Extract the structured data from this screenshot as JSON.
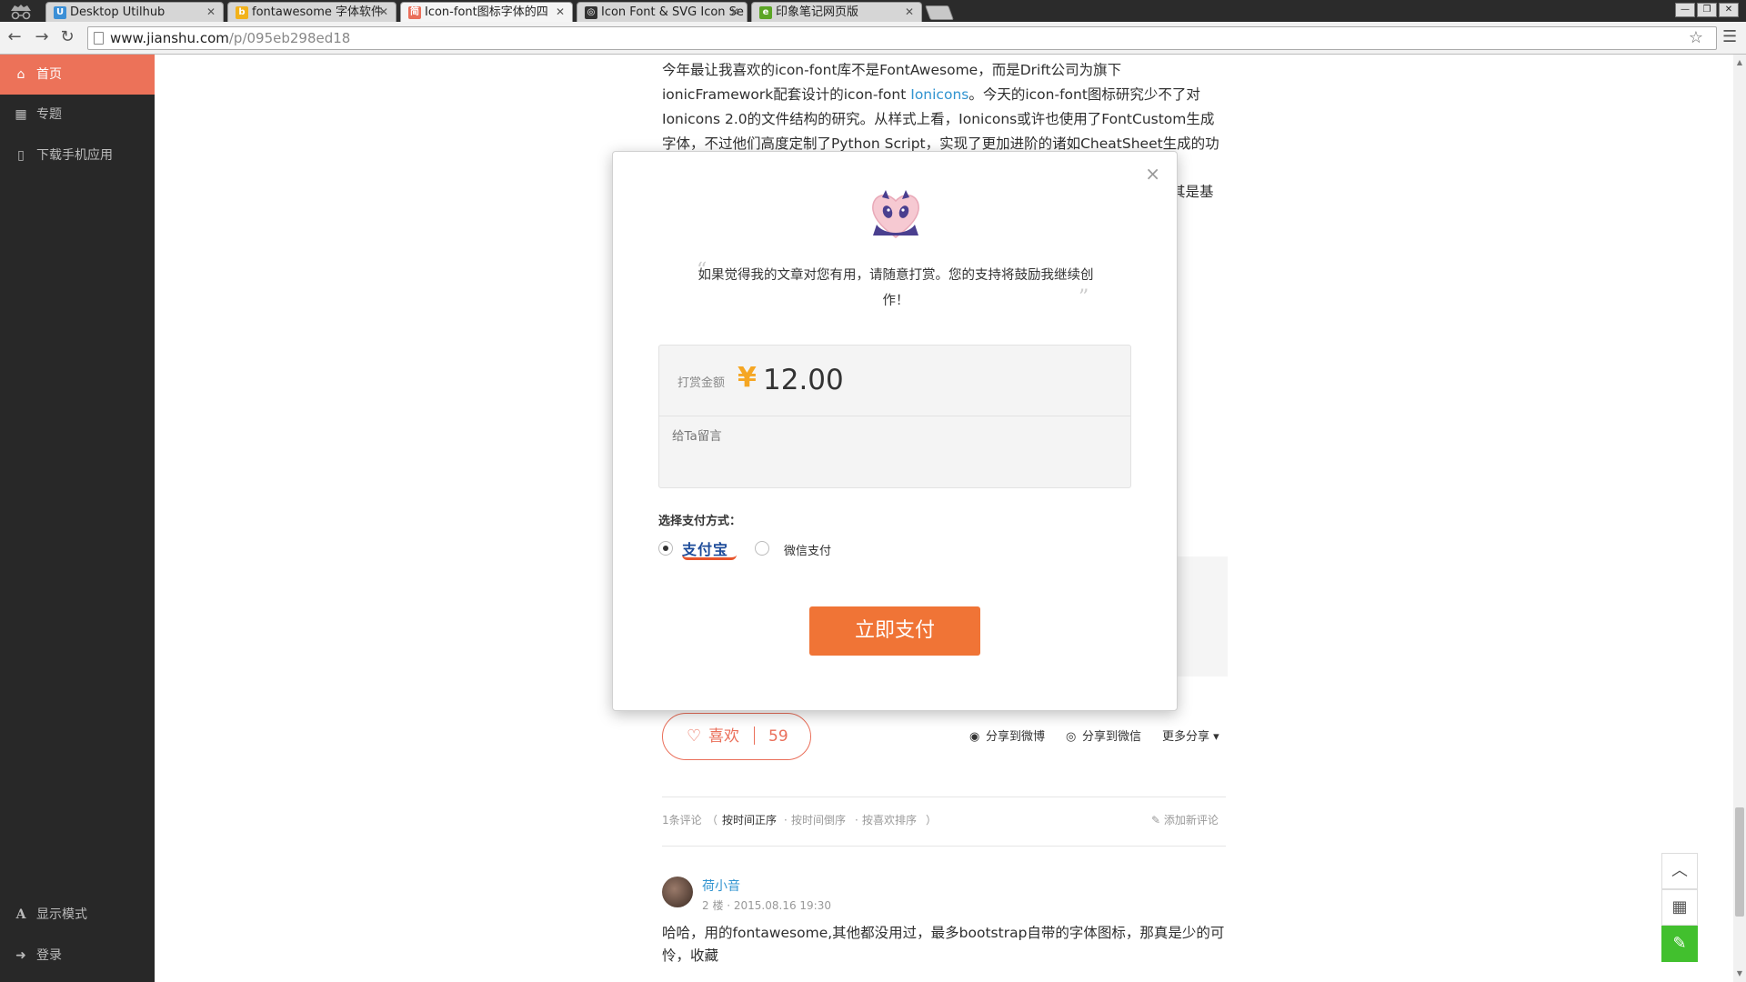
{
  "browser": {
    "tabs": [
      {
        "label": "Desktop Utilhub",
        "fav_color": "#3b8fd6",
        "fav_char": "U"
      },
      {
        "label": "fontawesome 字体软件",
        "fav_color": "#f2b21b",
        "fav_char": "b"
      },
      {
        "label": "Icon-font图标字体的四",
        "fav_color": "#ea6f5a",
        "fav_char": "简"
      },
      {
        "label": "Icon Font & SVG Icon Se",
        "fav_color": "#333333",
        "fav_char": "◎"
      },
      {
        "label": "印象笔记网页版",
        "fav_color": "#5ba525",
        "fav_char": "e"
      }
    ],
    "url_domain": "www.jianshu.com",
    "url_path": "/p/095eb298ed18"
  },
  "sidebar": {
    "items": [
      {
        "label": "首页",
        "icon": "home-icon",
        "glyph": "⌂"
      },
      {
        "label": "专题",
        "icon": "grid-icon",
        "glyph": "▦"
      },
      {
        "label": "下载手机应用",
        "icon": "phone-icon",
        "glyph": "▯"
      }
    ],
    "bottom": [
      {
        "label": "显示模式",
        "icon": "font-icon",
        "glyph": "A"
      },
      {
        "label": "登录",
        "icon": "login-icon",
        "glyph": "➜"
      }
    ]
  },
  "article": {
    "p1_a": "今年最让我喜欢的icon-font库不是FontAwesome，而是Drift公司为旗下ionicFramework配套设计的icon-font ",
    "p1_link": "Ionicons",
    "p1_b": "。今天的icon-font图标研究少不了对Ionicons 2.0的文件结构的研究。从样式上看，Ionicons或许也使用了FontCustom生成字体，不过他们高度定制了Python Script，实现了更加进阶的诸如CheatSheet生成的功能。",
    "p2_fragment": "其是基"
  },
  "like": {
    "label": "喜欢",
    "count": "59"
  },
  "share": {
    "weibo": "分享到微博",
    "wechat": "分享到微信",
    "more": "更多分享"
  },
  "comments": {
    "count_label": "1条评论",
    "open_paren": "（",
    "sort_time_asc": "按时间正序",
    "sort_time_desc": "按时间倒序",
    "sort_likes": "按喜欢排序",
    "close_paren": "）",
    "add": "添加新评论",
    "items": [
      {
        "author": "荷小音",
        "meta": "2 楼 · 2015.08.16 19:30",
        "text": "哈哈，用的fontawesome,其他都没用过，最多bootstrap自带的字体图标，那真是少的可怜，收藏"
      }
    ]
  },
  "modal": {
    "close": "×",
    "quote": "如果觉得我的文章对您有用，请随意打赏。您的支持将鼓励我继续创作！",
    "amount_label": "打赏金额",
    "currency": "¥",
    "amount": "12.00",
    "message_placeholder": "给Ta留言",
    "pay_method_title": "选择支付方式：",
    "alipay_label": "支付宝",
    "wechat_label": "微信支付",
    "selected_method": "alipay",
    "submit": "立即支付"
  },
  "colors": {
    "accent": "#ea6f5a",
    "pay_button": "#f07436",
    "edit_button": "#42c02e",
    "link": "#3194d0"
  }
}
